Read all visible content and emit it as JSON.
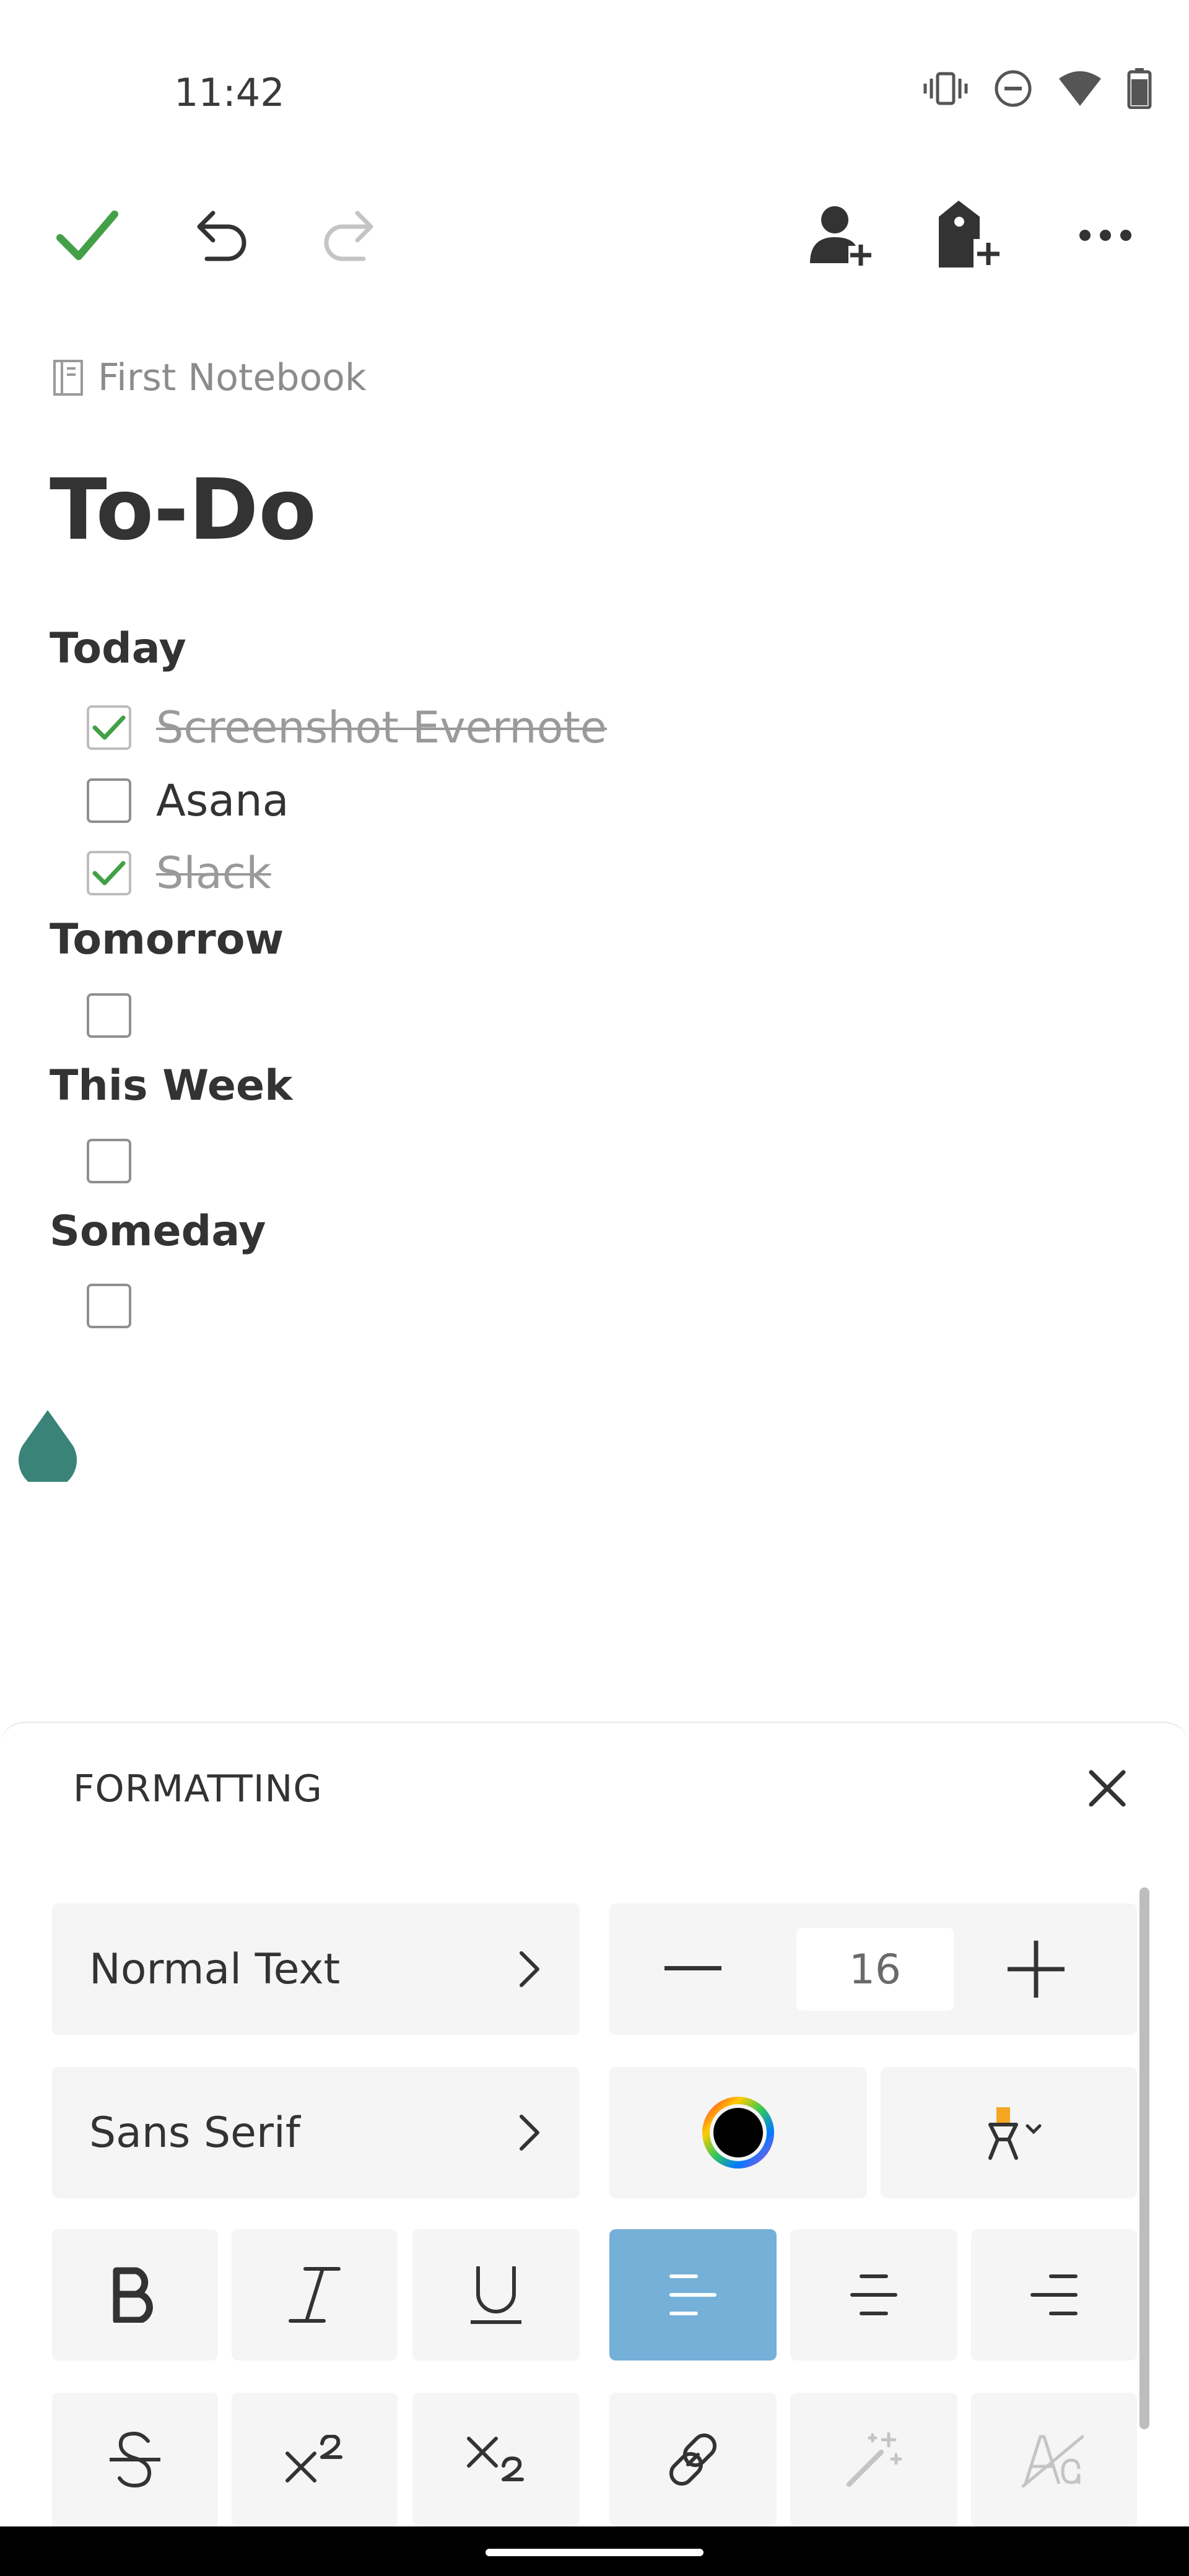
{
  "status_bar": {
    "time": "11:42",
    "icons": [
      "vibrate-icon",
      "dnd-icon",
      "wifi-icon",
      "battery-icon"
    ]
  },
  "toolbar": {
    "icons": [
      "check-icon",
      "undo-icon",
      "redo-icon",
      "share-user-icon",
      "add-tag-icon",
      "more-icon"
    ],
    "accent_color": "#43a047"
  },
  "note": {
    "notebook": "First Notebook",
    "title": "To-Do",
    "sections": [
      {
        "heading": "Today",
        "items": [
          {
            "text": "Screenshot Evernote",
            "checked": true
          },
          {
            "text": "Asana",
            "checked": false
          },
          {
            "text": "Slack",
            "checked": true
          }
        ]
      },
      {
        "heading": "Tomorrow",
        "items": [
          {
            "text": "",
            "checked": false
          }
        ]
      },
      {
        "heading": "This Week",
        "items": [
          {
            "text": "",
            "checked": false
          }
        ]
      },
      {
        "heading": "Someday",
        "items": [
          {
            "text": "",
            "checked": false
          }
        ]
      }
    ]
  },
  "formatting": {
    "title": "FORMATTING",
    "text_style": "Normal Text",
    "font_family": "Sans Serif",
    "font_size": "16",
    "text_color": "#000000",
    "selected_alignment": "align-left",
    "active_color": "#74b0d8",
    "buttons": [
      "bold",
      "italic",
      "underline",
      "align-left",
      "align-center",
      "align-right",
      "strikethrough",
      "superscript",
      "subscript",
      "link",
      "magic-wand",
      "clear-formatting"
    ]
  },
  "cursor_handle_color": "#3a8378"
}
